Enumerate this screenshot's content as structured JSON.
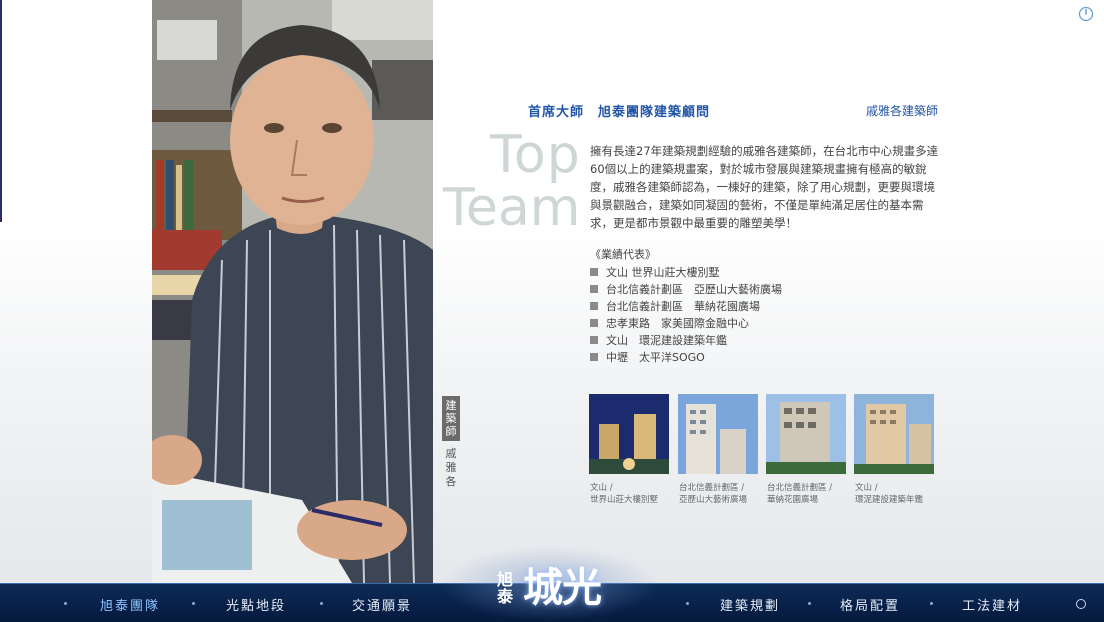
{
  "header": {
    "title": "首席大師　旭泰團隊建築顧問",
    "architect_role": "戚雅各建築師",
    "power_icon": "power-icon"
  },
  "hero": {
    "big_text_1": "Top",
    "big_text_2": "Team",
    "intro": "擁有長達27年建築規劃經驗的戚雅各建築師，在台北市中心規畫多達60個以上的建築規畫案，對於城市發展與建築規畫擁有極高的敏銳度，戚雅各建築師認為，一棟好的建築，除了用心規劃，更要與環境與景觀融合，建築如同凝固的藝術，不僅是單純滿足居住的基本需求，更是都市景觀中最重要的雕塑美學！"
  },
  "caption": {
    "role": "建築師",
    "name": "戚雅各"
  },
  "works": {
    "heading": "《業績代表》",
    "items": [
      "文山 世界山莊大樓別墅",
      "台北信義計劃區　亞歷山大藝術廣場",
      "台北信義計劃區　華納花園廣場",
      "忠孝東路　家美國際金融中心",
      "文山　環泥建設建築年鑑",
      "中壢　太平洋SOGO"
    ]
  },
  "thumbnails": [
    {
      "line1": "文山 /",
      "line2": "世界山莊大樓別墅"
    },
    {
      "line1": "台北信義計劃區 /",
      "line2": "亞歷山大藝術廣場"
    },
    {
      "line1": "台北信義計劃區 /",
      "line2": "華納花園廣場"
    },
    {
      "line1": "文山 /",
      "line2": "環泥建設建築年鑑"
    }
  ],
  "nav": {
    "items": [
      "旭泰團隊",
      "光點地段",
      "交通願景",
      "建築規劃",
      "格局配置",
      "工法建材"
    ],
    "active": "旭泰團隊",
    "logo_small": "旭泰",
    "logo_big": "城光"
  },
  "colors": {
    "accent_blue": "#2356a8",
    "nav_bg": "#082049",
    "active_nav": "#8ec6ff"
  }
}
